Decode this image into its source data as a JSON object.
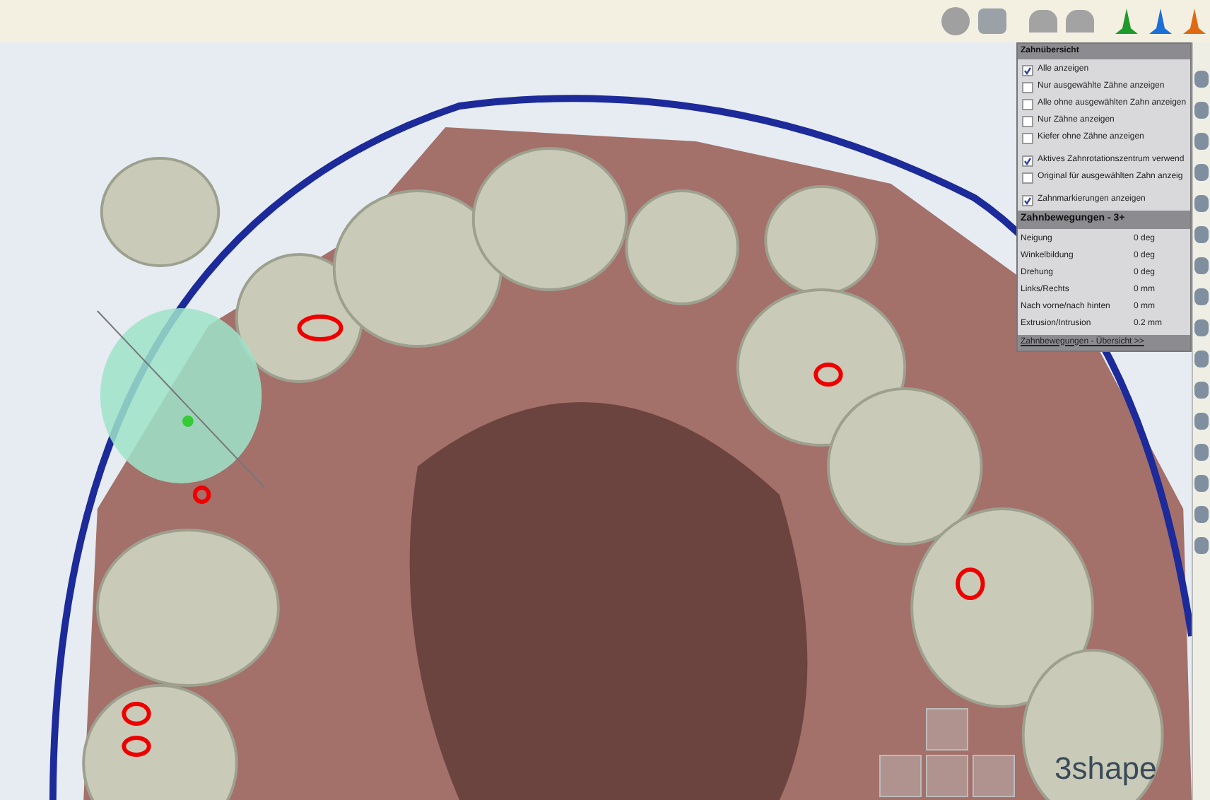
{
  "overview_panel": {
    "title": "Zahnübersicht",
    "options": [
      {
        "label": "Alle anzeigen",
        "checked": true
      },
      {
        "label": "Nur ausgewählte Zähne anzeigen",
        "checked": false
      },
      {
        "label": "Alle ohne ausgewählten Zahn anzeigen",
        "checked": false
      },
      {
        "label": "Nur Zähne anzeigen",
        "checked": false
      },
      {
        "label": "Kiefer ohne Zähne anzeigen",
        "checked": false
      },
      {
        "label": "Aktives Zahnrotationszentrum verwend",
        "checked": true
      },
      {
        "label": "Original für ausgewählten Zahn anzeig",
        "checked": false
      },
      {
        "label": "Zahnmarkierungen anzeigen",
        "checked": true
      }
    ]
  },
  "movement_panel": {
    "title": "Zahnbewegungen - 3+",
    "rows": [
      {
        "label": "Neigung",
        "value": "0 deg"
      },
      {
        "label": "Winkelbildung",
        "value": "0 deg"
      },
      {
        "label": "Drehung",
        "value": "0 deg"
      },
      {
        "label": "Links/Rechts",
        "value": "0 mm"
      },
      {
        "label": "Nach vorne/nach hinten",
        "value": "0 mm"
      },
      {
        "label": "Extrusion/Intrusion",
        "value": "0.2 mm"
      }
    ],
    "link": "Zahnbewegungen - Übersicht >>"
  },
  "logo": "3shape"
}
